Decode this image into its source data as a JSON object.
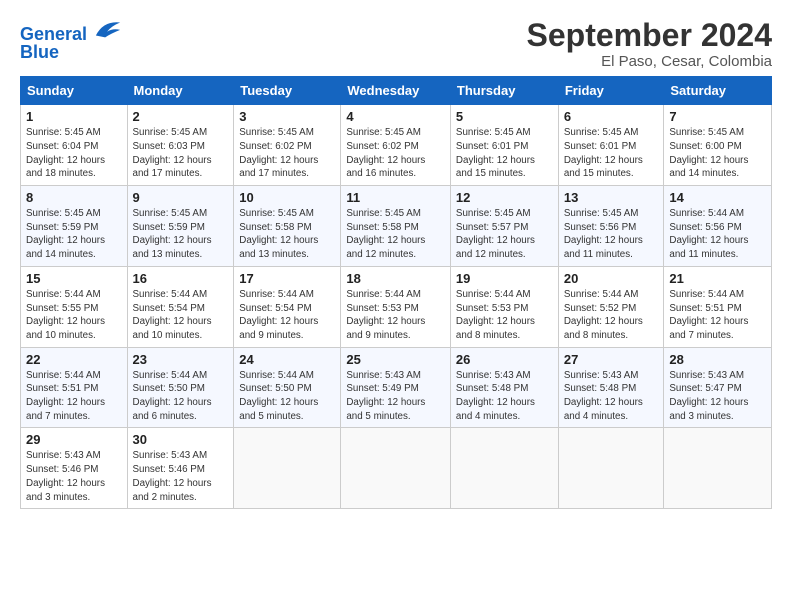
{
  "logo": {
    "line1": "General",
    "line2": "Blue"
  },
  "title": "September 2024",
  "location": "El Paso, Cesar, Colombia",
  "days_header": [
    "Sunday",
    "Monday",
    "Tuesday",
    "Wednesday",
    "Thursday",
    "Friday",
    "Saturday"
  ],
  "weeks": [
    [
      {
        "day": "1",
        "info": "Sunrise: 5:45 AM\nSunset: 6:04 PM\nDaylight: 12 hours\nand 18 minutes."
      },
      {
        "day": "2",
        "info": "Sunrise: 5:45 AM\nSunset: 6:03 PM\nDaylight: 12 hours\nand 17 minutes."
      },
      {
        "day": "3",
        "info": "Sunrise: 5:45 AM\nSunset: 6:02 PM\nDaylight: 12 hours\nand 17 minutes."
      },
      {
        "day": "4",
        "info": "Sunrise: 5:45 AM\nSunset: 6:02 PM\nDaylight: 12 hours\nand 16 minutes."
      },
      {
        "day": "5",
        "info": "Sunrise: 5:45 AM\nSunset: 6:01 PM\nDaylight: 12 hours\nand 15 minutes."
      },
      {
        "day": "6",
        "info": "Sunrise: 5:45 AM\nSunset: 6:01 PM\nDaylight: 12 hours\nand 15 minutes."
      },
      {
        "day": "7",
        "info": "Sunrise: 5:45 AM\nSunset: 6:00 PM\nDaylight: 12 hours\nand 14 minutes."
      }
    ],
    [
      {
        "day": "8",
        "info": "Sunrise: 5:45 AM\nSunset: 5:59 PM\nDaylight: 12 hours\nand 14 minutes."
      },
      {
        "day": "9",
        "info": "Sunrise: 5:45 AM\nSunset: 5:59 PM\nDaylight: 12 hours\nand 13 minutes."
      },
      {
        "day": "10",
        "info": "Sunrise: 5:45 AM\nSunset: 5:58 PM\nDaylight: 12 hours\nand 13 minutes."
      },
      {
        "day": "11",
        "info": "Sunrise: 5:45 AM\nSunset: 5:58 PM\nDaylight: 12 hours\nand 12 minutes."
      },
      {
        "day": "12",
        "info": "Sunrise: 5:45 AM\nSunset: 5:57 PM\nDaylight: 12 hours\nand 12 minutes."
      },
      {
        "day": "13",
        "info": "Sunrise: 5:45 AM\nSunset: 5:56 PM\nDaylight: 12 hours\nand 11 minutes."
      },
      {
        "day": "14",
        "info": "Sunrise: 5:44 AM\nSunset: 5:56 PM\nDaylight: 12 hours\nand 11 minutes."
      }
    ],
    [
      {
        "day": "15",
        "info": "Sunrise: 5:44 AM\nSunset: 5:55 PM\nDaylight: 12 hours\nand 10 minutes."
      },
      {
        "day": "16",
        "info": "Sunrise: 5:44 AM\nSunset: 5:54 PM\nDaylight: 12 hours\nand 10 minutes."
      },
      {
        "day": "17",
        "info": "Sunrise: 5:44 AM\nSunset: 5:54 PM\nDaylight: 12 hours\nand 9 minutes."
      },
      {
        "day": "18",
        "info": "Sunrise: 5:44 AM\nSunset: 5:53 PM\nDaylight: 12 hours\nand 9 minutes."
      },
      {
        "day": "19",
        "info": "Sunrise: 5:44 AM\nSunset: 5:53 PM\nDaylight: 12 hours\nand 8 minutes."
      },
      {
        "day": "20",
        "info": "Sunrise: 5:44 AM\nSunset: 5:52 PM\nDaylight: 12 hours\nand 8 minutes."
      },
      {
        "day": "21",
        "info": "Sunrise: 5:44 AM\nSunset: 5:51 PM\nDaylight: 12 hours\nand 7 minutes."
      }
    ],
    [
      {
        "day": "22",
        "info": "Sunrise: 5:44 AM\nSunset: 5:51 PM\nDaylight: 12 hours\nand 7 minutes."
      },
      {
        "day": "23",
        "info": "Sunrise: 5:44 AM\nSunset: 5:50 PM\nDaylight: 12 hours\nand 6 minutes."
      },
      {
        "day": "24",
        "info": "Sunrise: 5:44 AM\nSunset: 5:50 PM\nDaylight: 12 hours\nand 5 minutes."
      },
      {
        "day": "25",
        "info": "Sunrise: 5:43 AM\nSunset: 5:49 PM\nDaylight: 12 hours\nand 5 minutes."
      },
      {
        "day": "26",
        "info": "Sunrise: 5:43 AM\nSunset: 5:48 PM\nDaylight: 12 hours\nand 4 minutes."
      },
      {
        "day": "27",
        "info": "Sunrise: 5:43 AM\nSunset: 5:48 PM\nDaylight: 12 hours\nand 4 minutes."
      },
      {
        "day": "28",
        "info": "Sunrise: 5:43 AM\nSunset: 5:47 PM\nDaylight: 12 hours\nand 3 minutes."
      }
    ],
    [
      {
        "day": "29",
        "info": "Sunrise: 5:43 AM\nSunset: 5:46 PM\nDaylight: 12 hours\nand 3 minutes."
      },
      {
        "day": "30",
        "info": "Sunrise: 5:43 AM\nSunset: 5:46 PM\nDaylight: 12 hours\nand 2 minutes."
      },
      {
        "day": "",
        "info": ""
      },
      {
        "day": "",
        "info": ""
      },
      {
        "day": "",
        "info": ""
      },
      {
        "day": "",
        "info": ""
      },
      {
        "day": "",
        "info": ""
      }
    ]
  ]
}
